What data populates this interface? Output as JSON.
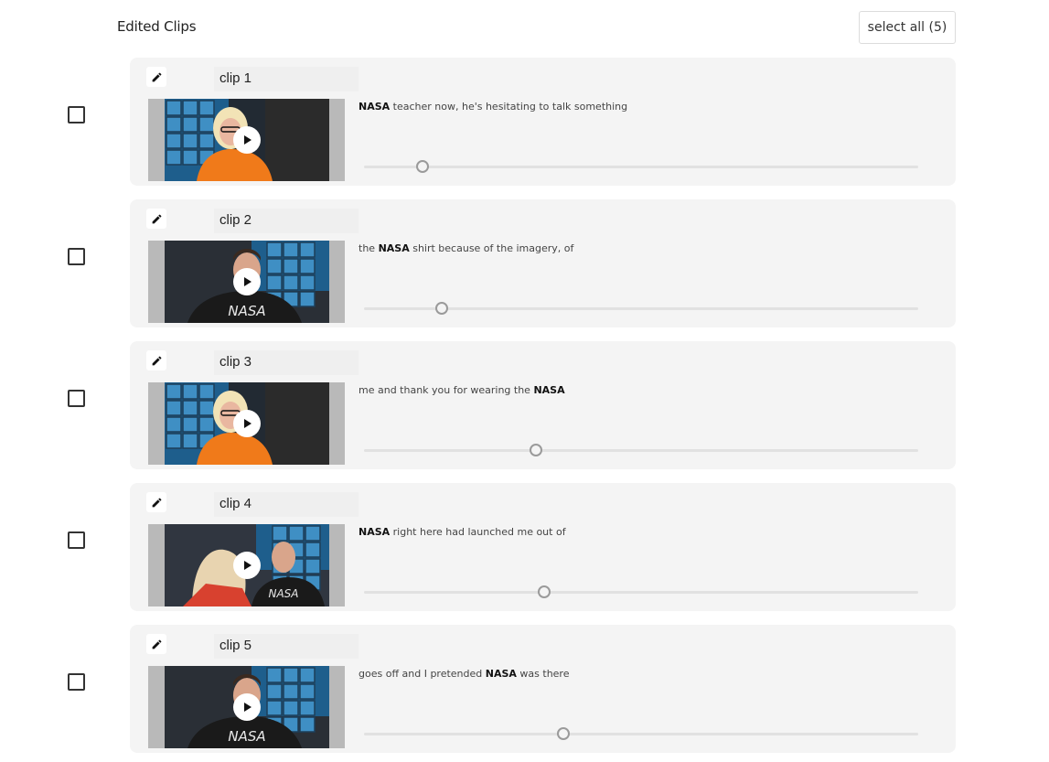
{
  "header": {
    "title": "Edited Clips",
    "select_all_label": "select all (5)"
  },
  "colors": {
    "card_bg": "#f4f4f4",
    "tile_blue": "#3f8fc4",
    "shirt_orange": "#f07a1a"
  },
  "clips": [
    {
      "name": "clip 1",
      "pre": "",
      "keyword": "NASA",
      "post": " teacher now, he's hesitating to talk something",
      "progress": 0.105,
      "scene": "woman"
    },
    {
      "name": "clip 2",
      "pre": "the ",
      "keyword": "NASA",
      "post": " shirt because of the imagery, of",
      "progress": 0.14,
      "scene": "man"
    },
    {
      "name": "clip 3",
      "pre": "me and thank you for wearing the ",
      "keyword": "NASA",
      "post": "",
      "progress": 0.31,
      "scene": "woman"
    },
    {
      "name": "clip 4",
      "pre": "",
      "keyword": "NASA",
      "post": " right here had launched me out of",
      "progress": 0.325,
      "scene": "both"
    },
    {
      "name": "clip 5",
      "pre": "goes off and I pretended ",
      "keyword": "NASA",
      "post": " was there",
      "progress": 0.36,
      "scene": "man"
    }
  ]
}
